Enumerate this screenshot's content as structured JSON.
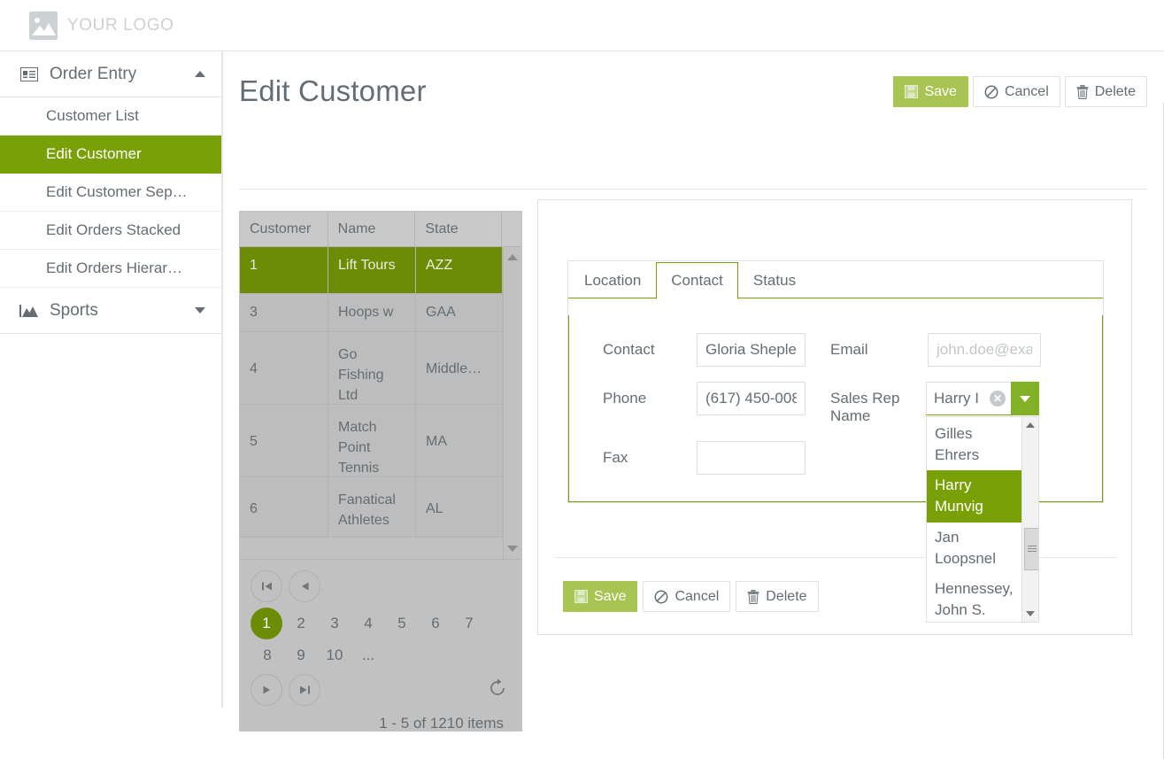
{
  "brand": {
    "logo_text": "YOUR LOGO",
    "logo_icon": "image-placeholder-icon",
    "accent_dark": "#7aa008",
    "accent_light": "#a8c553",
    "grid_select": "#6d8c05",
    "text": "#646d73"
  },
  "sidebar": {
    "groups": [
      {
        "label": "Order Entry",
        "icon": "contact-card-icon",
        "caret": "chevron-up-icon",
        "expanded": true,
        "items": [
          {
            "label": "Customer List",
            "selected": false
          },
          {
            "label": "Edit Customer",
            "selected": true
          },
          {
            "label": "Edit Customer Sep…",
            "selected": false
          },
          {
            "label": "Edit Orders Stacked",
            "selected": false
          },
          {
            "label": "Edit Orders Hierar…",
            "selected": false
          }
        ]
      },
      {
        "label": "Sports",
        "icon": "mountain-chart-icon",
        "caret": "chevron-down-icon",
        "expanded": false,
        "items": []
      }
    ]
  },
  "header": {
    "title": "Edit Customer",
    "actions": [
      {
        "label": "Save",
        "icon": "floppy-save-icon",
        "primary": true
      },
      {
        "label": "Cancel",
        "icon": "no-entry-icon",
        "primary": false
      },
      {
        "label": "Delete",
        "icon": "trash-icon",
        "primary": false
      }
    ]
  },
  "grid": {
    "columns": [
      "Customer",
      "Name",
      "State"
    ],
    "rows": [
      {
        "customer": "1",
        "name": "Lift Tours",
        "state": "AZZ",
        "selected": true
      },
      {
        "customer": "3",
        "name": "Hoops w",
        "state": "GAA",
        "selected": false
      },
      {
        "customer": "4",
        "name": "Go Fishing Ltd",
        "state": "Middle…",
        "selected": false
      },
      {
        "customer": "5",
        "name": "Match Point Tennis",
        "state": "MA",
        "selected": false
      },
      {
        "customer": "6",
        "name": "Fanatical Athletes",
        "state": "AL",
        "selected": false
      }
    ],
    "scroll_up_icon": "scroll-up-arrow-icon",
    "scroll_down_icon": "scroll-down-arrow-icon"
  },
  "pager": {
    "first_icon": "go-to-first-page-icon",
    "prev_icon": "previous-page-icon",
    "next_icon": "next-page-icon",
    "last_icon": "go-to-last-page-icon",
    "refresh_icon": "refresh-icon",
    "pages": [
      "1",
      "2",
      "3",
      "4",
      "5",
      "6",
      "7",
      "8",
      "9",
      "10",
      "..."
    ],
    "active_page": "1",
    "info": "1 - 5 of 1210 items"
  },
  "form": {
    "tabs": [
      {
        "label": "Location",
        "active": false
      },
      {
        "label": "Contact",
        "active": true
      },
      {
        "label": "Status",
        "active": false
      }
    ],
    "fields": {
      "contact_label": "Contact",
      "contact_value": "Gloria Sheple",
      "email_label": "Email",
      "email_value": "",
      "email_placeholder": "john.doe@exa",
      "phone_label": "Phone",
      "phone_value": "(617) 450-008",
      "sales_rep_label": "Sales Rep Name",
      "fax_label": "Fax",
      "fax_value": ""
    },
    "combo": {
      "value": "Harry I",
      "clear_icon": "clear-x-icon",
      "toggle_icon": "chevron-down-icon",
      "open": true,
      "options": [
        {
          "label": "Gilles Ehrers",
          "selected": false
        },
        {
          "label": "Harry Munvig",
          "selected": true
        },
        {
          "label": "Jan Loopsnel",
          "selected": false
        },
        {
          "label": "Hennessey, John S.",
          "selected": false
        }
      ],
      "scroll_up_icon": "scroll-up-arrow-icon",
      "scroll_down_icon": "scroll-down-arrow-icon"
    },
    "actions": [
      {
        "label": "Save",
        "icon": "floppy-save-icon",
        "primary": true
      },
      {
        "label": "Cancel",
        "icon": "no-entry-icon",
        "primary": false
      },
      {
        "label": "Delete",
        "icon": "trash-icon",
        "primary": false
      }
    ]
  }
}
